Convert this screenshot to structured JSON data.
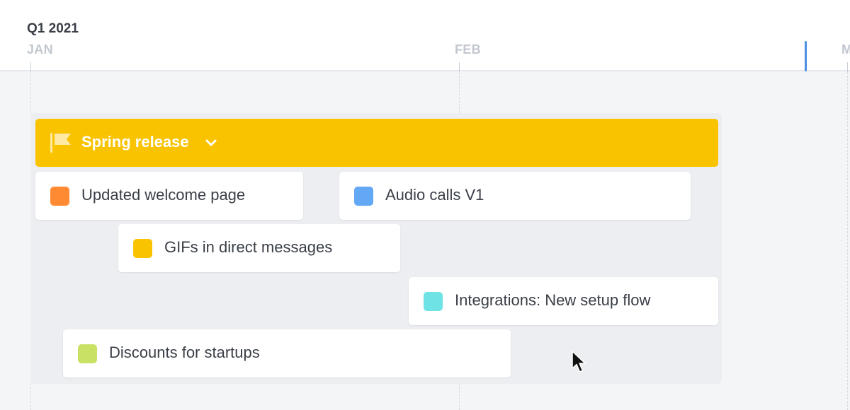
{
  "timeline": {
    "quarter": "Q1 2021",
    "months": [
      "JAN",
      "FEB",
      "M"
    ]
  },
  "milestone": {
    "label": "Spring release",
    "color": "#f9c300",
    "icon": "flag-icon",
    "toggle_icon": "chevron-down-icon"
  },
  "items": [
    {
      "label": "Updated welcome page",
      "color": "#ff8a32"
    },
    {
      "label": "Audio calls V1",
      "color": "#62a8f5"
    },
    {
      "label": "GIFs in direct messages",
      "color": "#f9c300"
    },
    {
      "label": "Integrations: New setup flow",
      "color": "#6ee2e4"
    },
    {
      "label": "Discounts for startups",
      "color": "#c9e265"
    }
  ],
  "colors": {
    "today_marker": "#4a90e2"
  }
}
